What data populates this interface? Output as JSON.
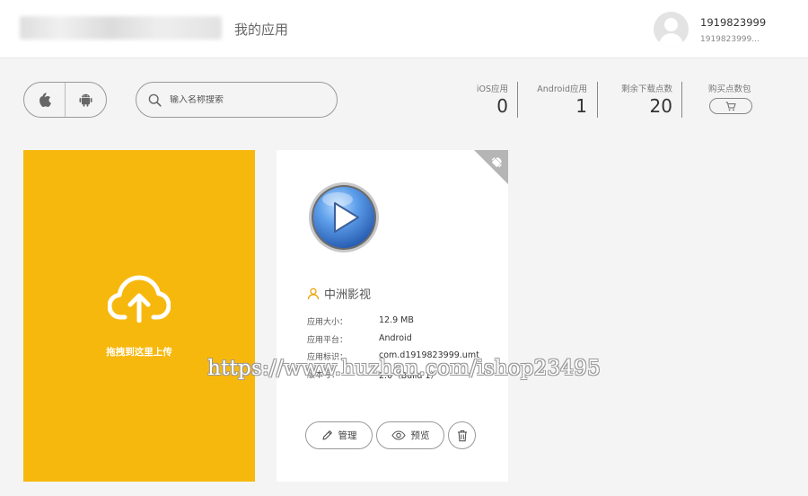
{
  "header": {
    "page_title": "我的应用",
    "user": {
      "name": "1919823999",
      "sub": "1919823999..."
    }
  },
  "toolbar": {
    "platforms": [
      {
        "name": "apple-icon"
      },
      {
        "name": "android-icon"
      }
    ],
    "search": {
      "placeholder": "输入名称搜索",
      "value": ""
    },
    "stats": [
      {
        "label": "iOS应用",
        "value": "0"
      },
      {
        "label": "Android应用",
        "value": "1"
      },
      {
        "label": "剩余下载点数",
        "value": "20"
      }
    ],
    "buy": {
      "label": "购买点数包",
      "icon": "cart-icon"
    }
  },
  "upload": {
    "text": "拖拽到这里上传",
    "icon": "cloud-upload-icon",
    "color": "#f7b80e"
  },
  "app": {
    "name": "中洲影视",
    "platform_tag_icon": "android-icon",
    "fields": [
      {
        "label": "应用大小：",
        "value": "12.9 MB"
      },
      {
        "label": "应用平台：",
        "value": "Android"
      },
      {
        "label": "应用标识：",
        "value": "com.d1919823999.umt"
      },
      {
        "label": "版本号：",
        "value": "2.0（Build 1）"
      }
    ],
    "actions": {
      "manage": "管理",
      "preview": "预览"
    }
  },
  "watermark": "https://www.huzhan.com/ishop23495"
}
